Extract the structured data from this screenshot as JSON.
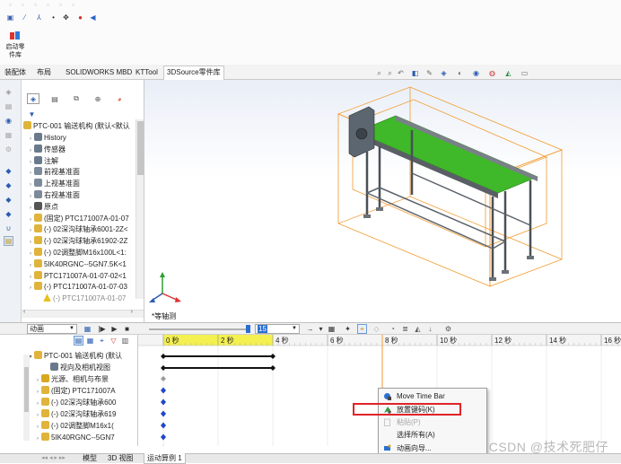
{
  "command": {
    "start_library_label_1": "启动零",
    "start_library_label_2": "件库"
  },
  "tabs": [
    "装配体",
    "布局",
    "SOLIDWORKS MBD",
    "KTTool",
    "3DSource零件库"
  ],
  "active_tab_index": 4,
  "tree": {
    "root": "PTC-001 输送机构  (默认<默认",
    "items": [
      {
        "label": "History",
        "indent": 1,
        "icon": "history-icon",
        "color": "#6a7a8c"
      },
      {
        "label": "传感器",
        "indent": 1,
        "icon": "sensor-icon",
        "color": "#6a7a8c"
      },
      {
        "label": "注解",
        "indent": 1,
        "icon": "annotation-icon",
        "color": "#6a7a8c"
      },
      {
        "label": "前视基准面",
        "indent": 1,
        "icon": "plane-icon",
        "color": "#7d8a99"
      },
      {
        "label": "上视基准面",
        "indent": 1,
        "icon": "plane-icon",
        "color": "#7d8a99"
      },
      {
        "label": "右视基准面",
        "indent": 1,
        "icon": "plane-icon",
        "color": "#7d8a99"
      },
      {
        "label": "原点",
        "indent": 1,
        "icon": "origin-icon",
        "color": "#555555"
      },
      {
        "label": "(固定) PTC171007A-01-07",
        "indent": 1,
        "icon": "part-icon",
        "color": "#e0b43a"
      },
      {
        "label": "(-) 02深沟球轴承6001-2Z<",
        "indent": 1,
        "icon": "part-icon",
        "color": "#e0b43a"
      },
      {
        "label": "(-) 02深沟球轴承61902-2Z",
        "indent": 1,
        "icon": "part-icon",
        "color": "#e0b43a"
      },
      {
        "label": "(-) 02调整脚M16x100L<1:",
        "indent": 1,
        "icon": "part-icon",
        "color": "#e0b43a"
      },
      {
        "label": "5IK40RGNC--5GN7.5K<1",
        "indent": 1,
        "icon": "part-icon",
        "color": "#e0b43a"
      },
      {
        "label": "PTC171007A-01-07-02<1",
        "indent": 1,
        "icon": "part-icon",
        "color": "#e0b43a"
      },
      {
        "label": "(-) PTC171007A-01-07-03",
        "indent": 1,
        "icon": "part-icon",
        "color": "#e0b43a"
      },
      {
        "label": "(-) PTC171007A-01-07",
        "indent": 2,
        "icon": "warning-icon",
        "color": "#e8c020"
      }
    ]
  },
  "viewport": {
    "view_label": "*等轴测"
  },
  "motion_toolbar": {
    "study_type": "动画",
    "time_box": "15",
    "study_type_options": [
      "动画"
    ]
  },
  "motion_tree": {
    "root": "PTC-001 输送机构 (默认",
    "items": [
      {
        "label": "视向及相机视图",
        "icon": "camera-icon"
      },
      {
        "label": "光源、相机与布景",
        "icon": "light-icon"
      },
      {
        "label": "(固定) PTC171007A",
        "icon": "part-icon"
      },
      {
        "label": "(-) 02深沟球轴承600",
        "icon": "part-icon"
      },
      {
        "label": "(-) 02深沟球轴承619",
        "icon": "part-icon"
      },
      {
        "label": "(-) 02调整脚M16x1(",
        "icon": "part-icon"
      },
      {
        "label": "5IK40RGNC--5GN7",
        "icon": "part-icon"
      }
    ]
  },
  "timeline": {
    "ticks": [
      "0 秒",
      "2 秒",
      "4 秒",
      "6 秒",
      "8 秒",
      "10 秒",
      "12 秒",
      "14 秒",
      "16 秒"
    ],
    "current_time_seconds": 8
  },
  "context_menu": {
    "items": [
      {
        "label": "Move Time Bar",
        "icon": "move-time-bar-icon",
        "disabled": false,
        "highlighted": false
      },
      {
        "label": "放置键码(K)",
        "icon": "place-key-icon",
        "disabled": false,
        "highlighted": true
      },
      {
        "label": "粘贴(P)",
        "icon": "paste-icon",
        "disabled": true,
        "highlighted": false
      },
      {
        "label": "选择所有(A)",
        "icon": "",
        "disabled": false,
        "highlighted": false
      },
      {
        "label": "动画向导...",
        "icon": "animation-wizard-icon",
        "disabled": false,
        "highlighted": false
      }
    ]
  },
  "bottom_tabs": [
    "模型",
    "3D 视图",
    "运动算例 1"
  ],
  "active_bottom_tab_index": 2,
  "watermark": "CSDN @技术死肥仔",
  "colors": {
    "conveyor_belt": "#3fb82a",
    "bounding_box": "#f29b2e",
    "highlight_box": "#e0242a",
    "time_marker": "#f39a35",
    "keyframe": "#1f46c8"
  }
}
